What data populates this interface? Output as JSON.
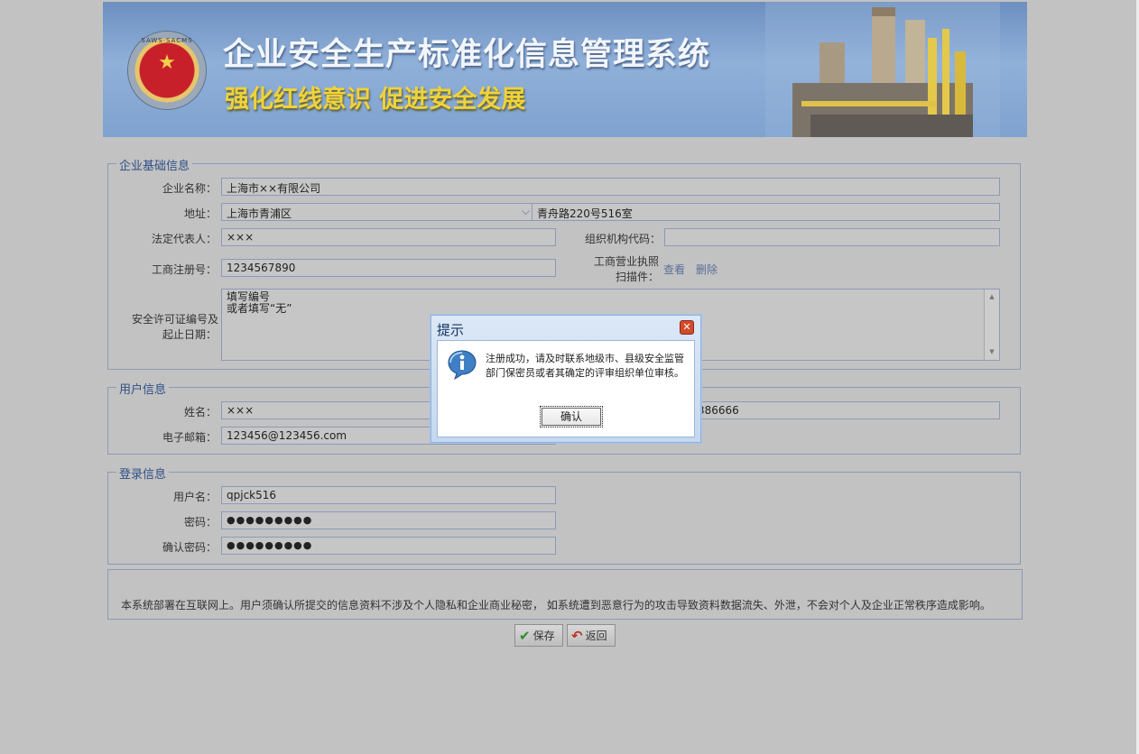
{
  "banner": {
    "seal_text": "SAWS·SACMS",
    "title": "企业安全生产标准化信息管理系统",
    "slogan": "强化红线意识 促进安全发展"
  },
  "enterprise": {
    "legend": "企业基础信息",
    "name_label": "企业名称：",
    "name_value": "上海市××有限公司",
    "address_label": "地址：",
    "district_value": "上海市青浦区",
    "street_value": "青舟路220号516室",
    "legal_rep_label": "法定代表人：",
    "legal_rep_value": "×××",
    "org_code_label": "组织机构代码：",
    "org_code_value": "",
    "reg_no_label": "工商注册号：",
    "reg_no_value": "1234567890",
    "license_label_1": "工商营业执照",
    "license_label_2": "扫描件：",
    "view_link": "查看",
    "delete_link": "删除",
    "permit_label_1": "安全许可证编号及",
    "permit_label_2": "起止日期：",
    "permit_value_1": "填写编号",
    "permit_value_2": "或者填写“无”"
  },
  "user": {
    "legend": "用户信息",
    "name_label": "姓名：",
    "name_value": "×××",
    "phone_value_partial": "386666",
    "email_label": "电子邮箱：",
    "email_value": "123456@123456.com"
  },
  "login": {
    "legend": "登录信息",
    "username_label": "用户名：",
    "username_value": "qpjck516",
    "password_label": "密码：",
    "password_value": "●●●●●●●●●",
    "confirm_label": "确认密码：",
    "confirm_value": "●●●●●●●●●"
  },
  "notice": "本系统部署在互联网上。用户须确认所提交的信息资料不涉及个人隐私和企业商业秘密， 如系统遭到恶意行为的攻击导致资料数据流失、外泄，不会对个人及企业正常秩序造成影响。",
  "buttons": {
    "save": "保存",
    "back": "返回"
  },
  "dialog": {
    "title": "提示",
    "message": "注册成功，请及时联系地级市、县级安全监管部门保密员或者其确定的评审组织单位审核。",
    "ok": "确认"
  },
  "colors": {
    "legend": "#2f4f88",
    "border": "#8a9bb8",
    "slogan": "#f0d23a",
    "background": "#c2c2c2"
  }
}
